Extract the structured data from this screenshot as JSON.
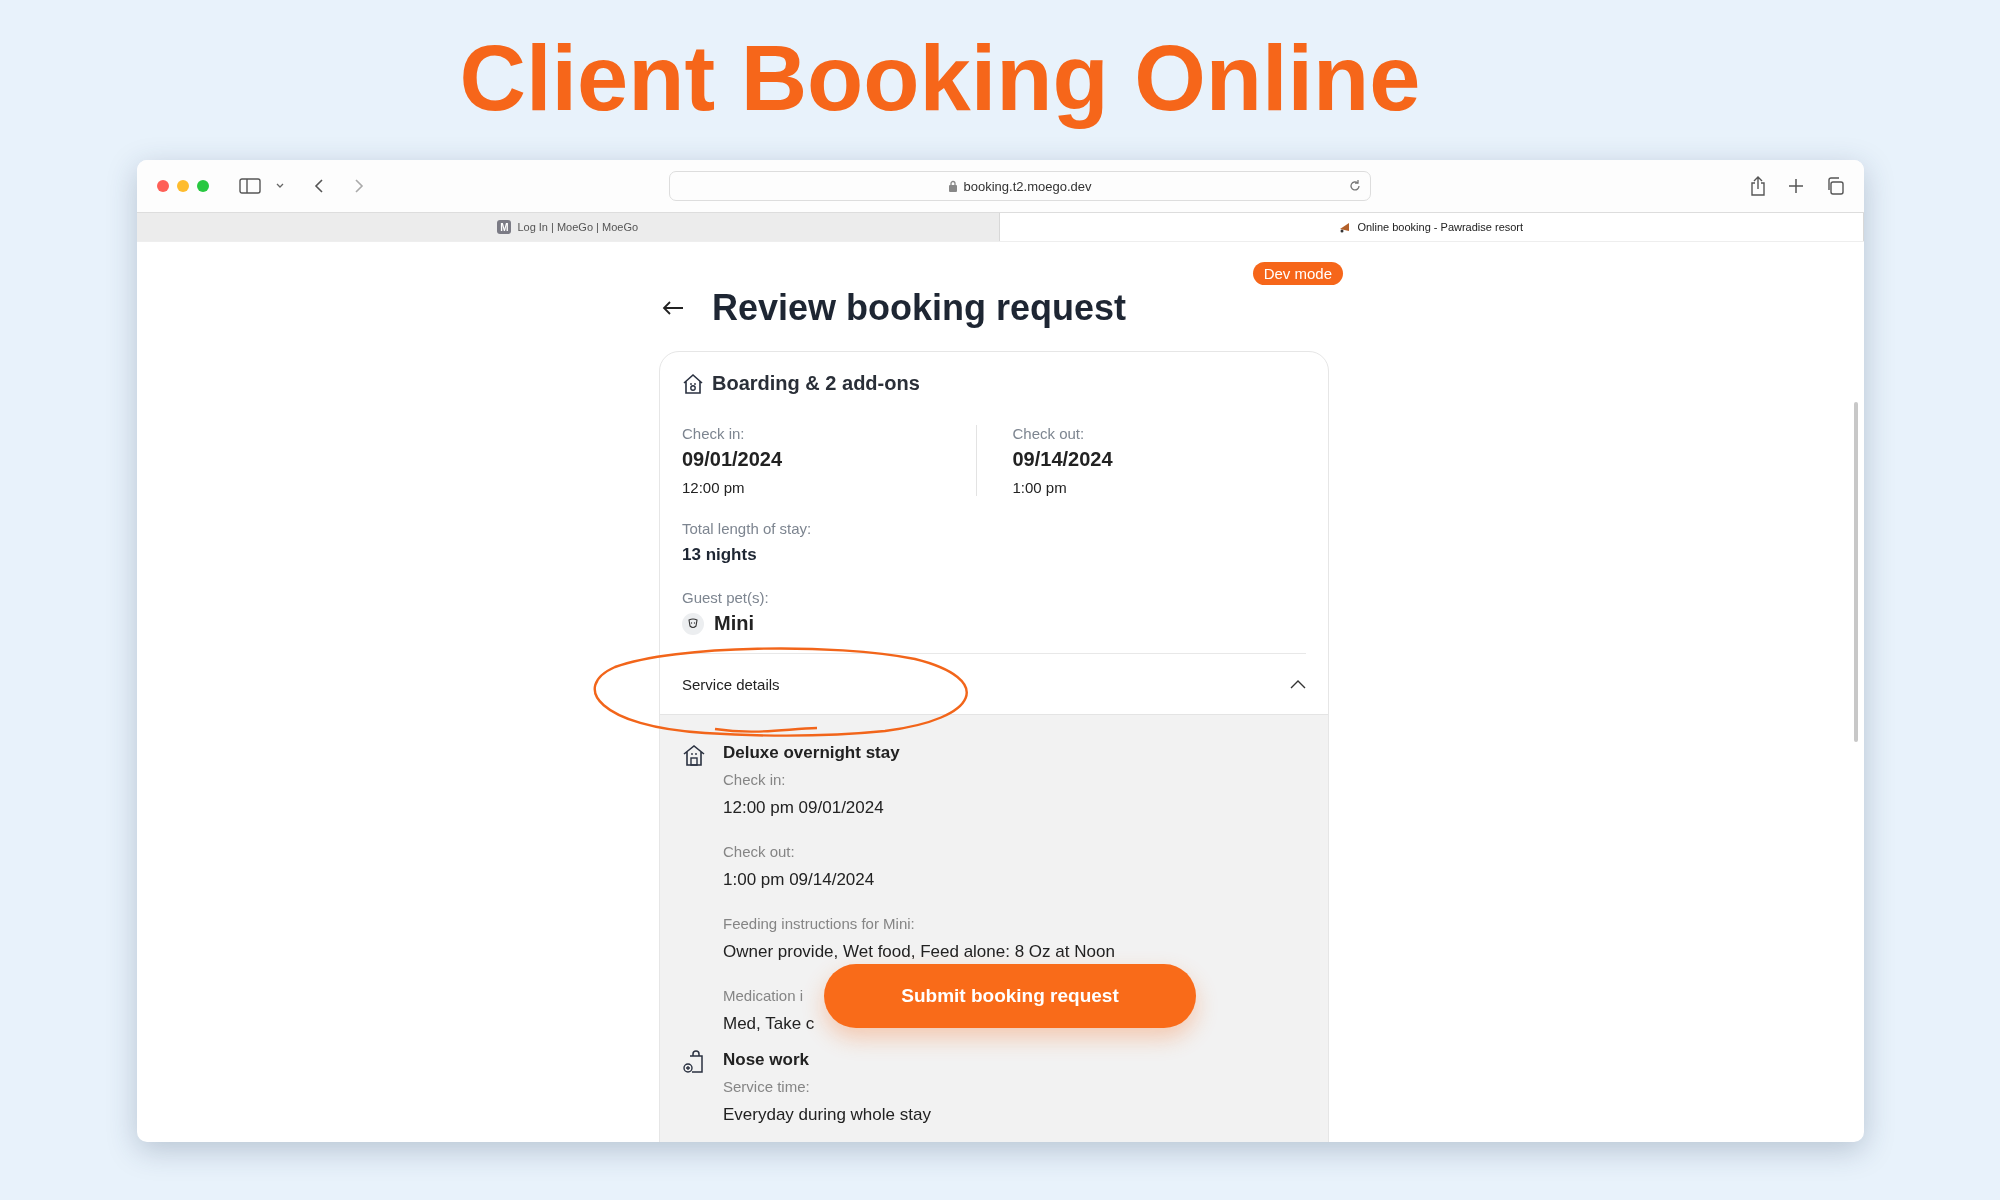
{
  "page_title": "Client Booking Online",
  "browser": {
    "url": "booking.t2.moego.dev",
    "tabs": [
      {
        "label": "Log In | MoeGo | MoeGo",
        "selected": false,
        "icon_letter": "M"
      },
      {
        "label": "Online booking - Pawradise resort",
        "selected": true
      }
    ]
  },
  "dev_badge": "Dev mode",
  "heading": "Review booking request",
  "summary": {
    "title": "Boarding & 2 add-ons",
    "check_in": {
      "label": "Check in:",
      "date": "09/01/2024",
      "time": "12:00 pm"
    },
    "check_out": {
      "label": "Check out:",
      "date": "09/14/2024",
      "time": "1:00 pm"
    },
    "stay": {
      "label": "Total length of stay:",
      "value": "13 nights"
    },
    "pets": {
      "label": "Guest pet(s):",
      "names": [
        "Mini"
      ]
    }
  },
  "service_details": {
    "label": "Service details",
    "expanded": true,
    "services": [
      {
        "kind": "boarding",
        "name": "Deluxe overnight stay",
        "fields": [
          {
            "label": "Check in:",
            "value": "12:00 pm 09/01/2024"
          },
          {
            "label": "Check out:",
            "value": "1:00 pm 09/14/2024"
          },
          {
            "label": "Feeding instructions for Mini:",
            "value": "Owner provide, Wet food, Feed alone: 8 Oz at Noon"
          },
          {
            "label": "Medication i",
            "value": "Med, Take c"
          }
        ]
      },
      {
        "kind": "addon",
        "name": "Nose work",
        "fields": [
          {
            "label": "Service time:",
            "value": "Everyday during whole stay"
          }
        ]
      }
    ]
  },
  "submit_button": "Submit booking request"
}
